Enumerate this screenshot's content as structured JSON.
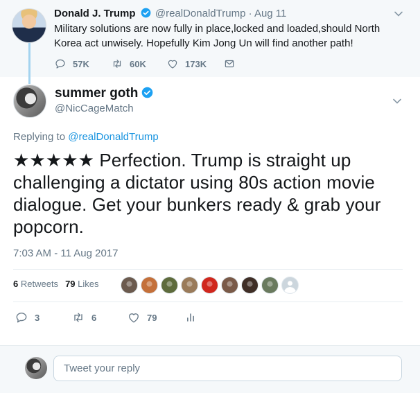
{
  "parent_tweet": {
    "name": "Donald J. Trump",
    "handle": "@realDonaldTrump",
    "separator": "·",
    "time": "Aug 11",
    "text": "Military solutions are now fully in place,locked and loaded,should North Korea act unwisely.  Hopefully Kim Jong Un will find another path!",
    "replies": "57K",
    "retweets": "60K",
    "likes": "173K"
  },
  "main_tweet": {
    "name": "summer goth",
    "handle": "@NicCageMatch",
    "replying_prefix": "Replying to",
    "replying_to": "@realDonaldTrump",
    "text": "★★★★★ Perfection. Trump is straight up challenging a dictator using 80s action movie dialogue. Get your bunkers ready & grab your popcorn.",
    "timestamp": "7:03 AM - 11 Aug 2017",
    "retweet_count": "6",
    "retweet_label": "Retweets",
    "like_count": "79",
    "like_label": "Likes",
    "reply_count": "3",
    "retweet_action_count": "6",
    "like_action_count": "79"
  },
  "liker_avatars": [
    {
      "name": "liker-avatar",
      "color": "#6b5a4e"
    },
    {
      "name": "liker-avatar",
      "color": "#c4703a"
    },
    {
      "name": "liker-avatar",
      "color": "#5e6b3c"
    },
    {
      "name": "liker-avatar",
      "color": "#9a7b5a"
    },
    {
      "name": "liker-avatar",
      "color": "#d0271d"
    },
    {
      "name": "liker-avatar",
      "color": "#7a5a48"
    },
    {
      "name": "liker-avatar",
      "color": "#3f2e26"
    },
    {
      "name": "liker-avatar",
      "color": "#6a7a5e"
    },
    {
      "name": "default-avatar",
      "color": "#ccd6dd"
    }
  ],
  "reply_box": {
    "placeholder": "Tweet your reply"
  },
  "colors": {
    "accent": "#1b95e0",
    "verified": "#1da1f2",
    "muted": "#657786",
    "thread_line": "#a3d3ef",
    "background_band": "#f5f8fa"
  },
  "icons": [
    "verified-badge-icon",
    "chevron-down-icon",
    "reply-icon",
    "retweet-icon",
    "like-icon",
    "message-icon",
    "analytics-icon"
  ]
}
